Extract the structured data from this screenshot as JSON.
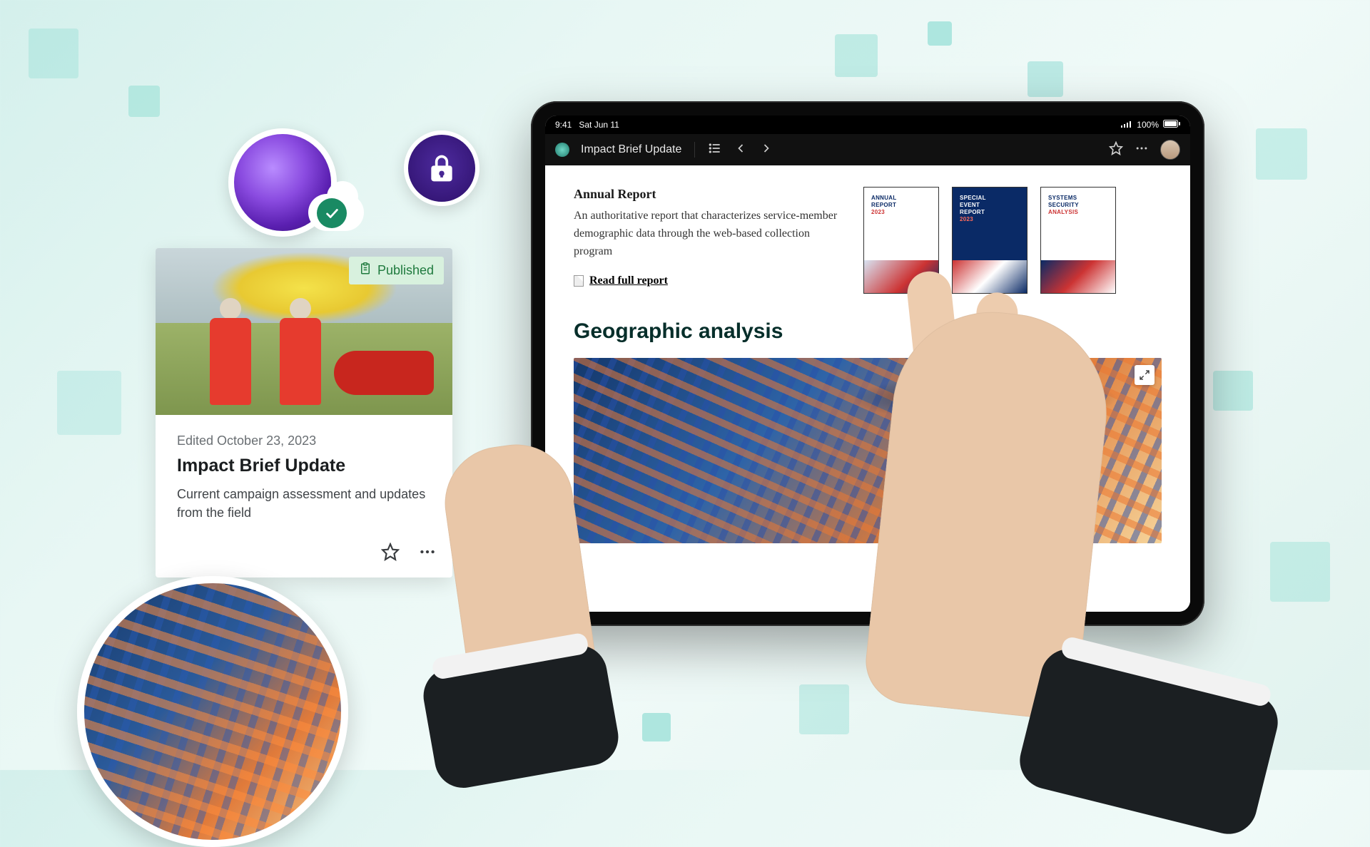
{
  "card": {
    "status_label": "Published",
    "edited_label": "Edited October 23, 2023",
    "title": "Impact Brief Update",
    "description": "Current campaign assessment and updates from the field"
  },
  "tablet": {
    "status_bar": {
      "time": "9:41",
      "date": "Sat Jun 11",
      "battery": "100%"
    },
    "topbar_title": "Impact Brief Update",
    "annual": {
      "heading": "Annual Report",
      "body": "An authoritative report that characterizes service-member demographic data through the web-based collection program",
      "link_label": "Read full report"
    },
    "thumbs": [
      {
        "line1": "ANNUAL",
        "line2": "REPORT",
        "line3": "2023"
      },
      {
        "line1": "SPECIAL",
        "line2": "EVENT",
        "line3": "REPORT",
        "line4": "2023"
      },
      {
        "line1": "SYSTEMS",
        "line2": "SECURITY",
        "line3": "ANALYSIS"
      }
    ],
    "section_heading": "Geographic analysis"
  }
}
